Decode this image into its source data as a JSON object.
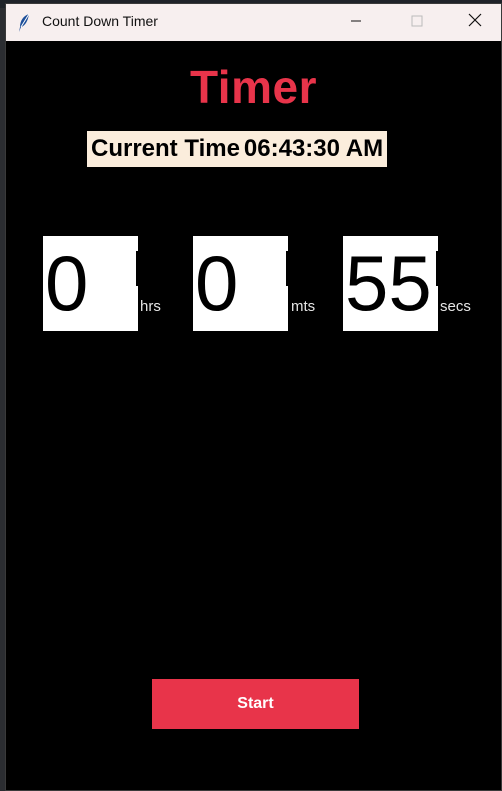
{
  "window": {
    "title": "Count Down Timer"
  },
  "app": {
    "heading": "Timer",
    "clock_label": "Current Time",
    "clock_value": "06:43:30 AM"
  },
  "fields": [
    {
      "value": "0",
      "unit": "hrs"
    },
    {
      "value": "0",
      "unit": "mts"
    },
    {
      "value": "55",
      "unit": "secs"
    }
  ],
  "controls": {
    "start_label": "Start"
  },
  "colors": {
    "accent": "#e8344a",
    "clock_bg": "#fbeddc",
    "window_bg": "#000000",
    "titlebar_bg": "#f7efef"
  },
  "icons": {
    "app": "feather-icon",
    "minimize": "minimize-icon",
    "maximize": "maximize-icon",
    "close": "close-icon"
  }
}
